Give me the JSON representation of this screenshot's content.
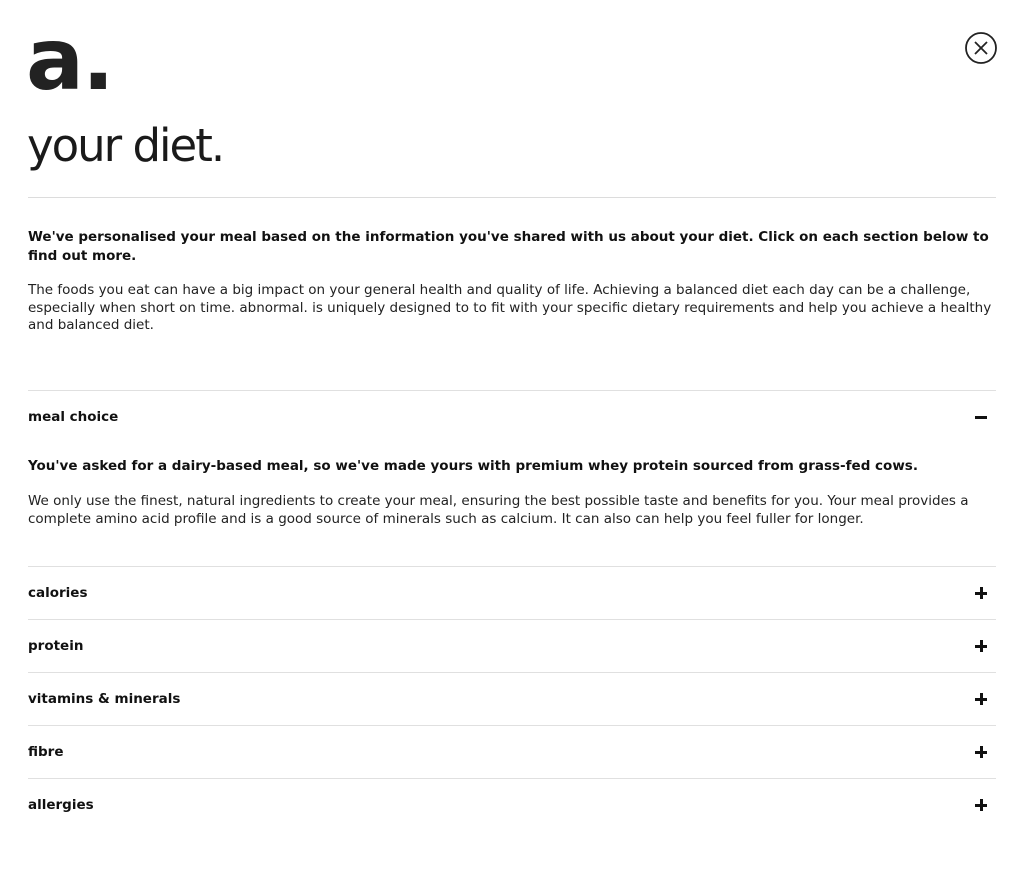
{
  "brand": {
    "logo_text": "a."
  },
  "header": {
    "title": "your diet.",
    "close_icon": "close-circle-icon"
  },
  "intro": {
    "lead": "We've personalised your meal based on the information you've shared with us about your diet. Click on each section below to find out more.",
    "body": "The foods you eat can have a big impact on your general health and quality of life. Achieving a balanced diet each day can be a challenge, especially when short on time. abnormal. is uniquely designed to to fit with your specific dietary requirements and help you achieve a healthy and balanced diet."
  },
  "accordion": {
    "items": [
      {
        "label": "meal choice",
        "expanded": true,
        "toggle_icon": "minus-icon",
        "lead": "You've asked for a dairy-based meal, so we've made yours with premium whey protein sourced from grass-fed cows.",
        "body": "We only use the finest, natural ingredients to create your meal, ensuring the best possible taste and benefits for you. Your meal provides a complete amino acid profile and is a good source of minerals such as calcium. It can also can help you feel fuller for longer."
      },
      {
        "label": "calories",
        "expanded": false,
        "toggle_icon": "plus-icon"
      },
      {
        "label": "protein",
        "expanded": false,
        "toggle_icon": "plus-icon"
      },
      {
        "label": "vitamins & minerals",
        "expanded": false,
        "toggle_icon": "plus-icon"
      },
      {
        "label": "fibre",
        "expanded": false,
        "toggle_icon": "plus-icon"
      },
      {
        "label": "allergies",
        "expanded": false,
        "toggle_icon": "plus-icon"
      }
    ]
  }
}
